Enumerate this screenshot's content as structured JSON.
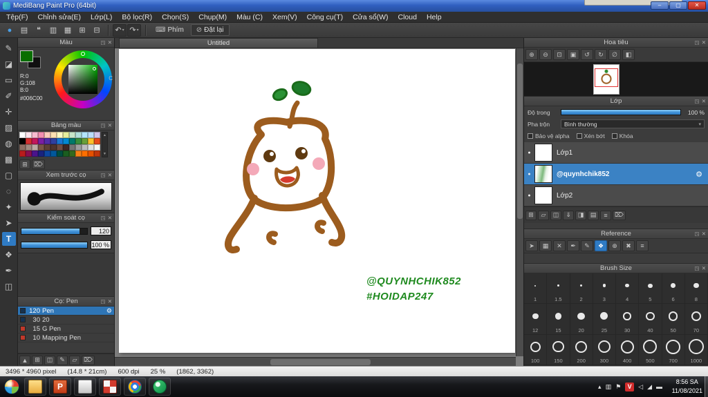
{
  "window": {
    "title": "MediBang Paint Pro (64bit)",
    "controls": [
      {
        "name": "minimize-button",
        "glyph": "–"
      },
      {
        "name": "maximize-button",
        "glyph": "▢"
      },
      {
        "name": "close-button",
        "glyph": "✕"
      }
    ]
  },
  "menu": {
    "items": [
      "Tệp(F)",
      "Chỉnh sửa(E)",
      "Lớp(L)",
      "Bộ lọc(R)",
      "Chọn(S)",
      "Chụp(M)",
      "Màu (C)",
      "Xem(V)",
      "Công cụ(T)",
      "Cửa sổ(W)",
      "Cloud",
      "Help"
    ]
  },
  "main_toolbar": {
    "icons": [
      {
        "name": "cloud-sync-icon",
        "glyph": "●",
        "color": "#4aa0e8"
      },
      {
        "name": "save-icon",
        "glyph": "▤"
      },
      {
        "name": "comment-icon",
        "glyph": "❝"
      },
      {
        "name": "panels-icon",
        "glyph": "▥"
      },
      {
        "name": "image-icon",
        "glyph": "▦"
      },
      {
        "name": "grid-icon",
        "glyph": "⊞"
      },
      {
        "name": "snap-icon",
        "glyph": "⊟"
      }
    ],
    "undo_glyph": "↶",
    "redo_glyph": "↷",
    "phim_icon": "⌨",
    "phim_label": "Phím",
    "reset_icon": "⊘",
    "reset_label": "Đặt lại"
  },
  "tools": [
    {
      "name": "pen-tool",
      "glyph": "✎"
    },
    {
      "name": "eraser-tool",
      "glyph": "◪"
    },
    {
      "name": "shape-brush-tool",
      "glyph": "▭"
    },
    {
      "name": "marker-tool",
      "glyph": "✐"
    },
    {
      "name": "move-tool",
      "glyph": "✛"
    },
    {
      "name": "fill-tool",
      "glyph": "▨"
    },
    {
      "name": "bucket-tool",
      "glyph": "◍"
    },
    {
      "name": "gradient-tool",
      "glyph": "▩"
    },
    {
      "name": "select-tool",
      "glyph": "▢"
    },
    {
      "name": "lasso-tool",
      "glyph": "◌"
    },
    {
      "name": "magic-wand-tool",
      "glyph": "✦"
    },
    {
      "name": "select-pen-tool",
      "glyph": "➤"
    },
    {
      "name": "text-tool",
      "glyph": "T",
      "active": true
    },
    {
      "name": "hand-tool",
      "glyph": "❖"
    },
    {
      "name": "eyedropper-tool",
      "glyph": "✒"
    },
    {
      "name": "divide-tool",
      "glyph": "◫"
    }
  ],
  "color_panel": {
    "title": "Màu",
    "r": "R:0",
    "g": "G:108",
    "b": "B:0",
    "hex": "#006C00",
    "c_label": "C",
    "foreground": "#0a6e00",
    "background": "#101010"
  },
  "palette": {
    "title": "Bảng màu",
    "colors": [
      "#ffffff",
      "#fce4ec",
      "#f8bbd0",
      "#f48fb1",
      "#ffccbc",
      "#ffe0b2",
      "#fff9c4",
      "#e6ee9c",
      "#c8e6c9",
      "#b2dfdb",
      "#b3e5fc",
      "#bbdefb",
      "#d1c4e9",
      "#000000",
      "#d32f2f",
      "#c2185b",
      "#7b1fa2",
      "#512da8",
      "#303f9f",
      "#1976d2",
      "#0288d1",
      "#00796b",
      "#388e3c",
      "#689f38",
      "#fbc02d",
      "#e64a19",
      "#8d6e63",
      "#a1887f",
      "#bcaaa4",
      "#795548",
      "#5d4037",
      "#4e342e",
      "#6d4c41",
      "#3e2723",
      "#757575",
      "#9e9e9e",
      "#bdbdbd",
      "#e0e0e0",
      "#f5f5f5",
      "#b71c1c",
      "#880e4f",
      "#4a148c",
      "#1a237e",
      "#0d47a1",
      "#01579b",
      "#004d40",
      "#1b5e20",
      "#33691e",
      "#f57f17",
      "#ff6f00",
      "#e65100",
      "#bf360c"
    ],
    "footer_icons": [
      {
        "name": "add-color-icon",
        "glyph": "⊞"
      },
      {
        "name": "delete-color-icon",
        "glyph": "⌦"
      }
    ]
  },
  "preview": {
    "title": "Xem trước cọ"
  },
  "control": {
    "title": "Kiểm soát cọ",
    "size": "120",
    "opacity": "100 %"
  },
  "brushes": {
    "title": "Cọ: Pen",
    "items": [
      {
        "size": "120",
        "name": "Pen",
        "chip": "#16324f",
        "selected": true
      },
      {
        "size": "30",
        "name": "20",
        "chip": "#16324f"
      },
      {
        "size": "15",
        "name": "G Pen",
        "chip": "#c0392b"
      },
      {
        "size": "10",
        "name": "Mapping Pen",
        "chip": "#c0392b"
      }
    ],
    "footer_icons": [
      {
        "name": "brush-up-icon",
        "glyph": "▲"
      },
      {
        "name": "add-brush-icon",
        "glyph": "⊞"
      },
      {
        "name": "duplicate-brush-icon",
        "glyph": "◫"
      },
      {
        "name": "edit-brush-icon",
        "glyph": "✎"
      },
      {
        "name": "brush-folder-icon",
        "glyph": "▱"
      },
      {
        "name": "delete-brush-icon",
        "glyph": "⌦"
      }
    ]
  },
  "canvas": {
    "tab": "Untitled",
    "handle1": "@QUYNHCHIK852",
    "handle2": "#HOIDAP247"
  },
  "navigator": {
    "title": "Hoa tiêu",
    "icons": [
      {
        "name": "zoom-in-icon",
        "glyph": "⊕"
      },
      {
        "name": "zoom-out-icon",
        "glyph": "⊖"
      },
      {
        "name": "fit-window-icon",
        "glyph": "⊡"
      },
      {
        "name": "actual-size-icon",
        "glyph": "▣"
      },
      {
        "name": "rotate-left-icon",
        "glyph": "↺"
      },
      {
        "name": "rotate-right-icon",
        "glyph": "↻"
      },
      {
        "name": "reset-view-icon",
        "glyph": "∅"
      },
      {
        "name": "flip-view-icon",
        "glyph": "◧"
      }
    ]
  },
  "layer_panel": {
    "title": "Lớp",
    "opacity_label": "Độ trong",
    "opacity_value": "100 %",
    "blend_label": "Pha trộn",
    "blend_value": "Bình thường",
    "checks": [
      "Bảo vệ alpha",
      "Xén bớt",
      "Khóa"
    ],
    "layers": [
      {
        "name": "Lớp1"
      },
      {
        "name": "@quynhchik852",
        "selected": true,
        "art": true
      },
      {
        "name": "Lớp2"
      }
    ],
    "footer_icons": [
      {
        "name": "add-layer-icon",
        "glyph": "⊞"
      },
      {
        "name": "add-folder-icon",
        "glyph": "▱"
      },
      {
        "name": "duplicate-layer-icon",
        "glyph": "◫"
      },
      {
        "name": "merge-down-icon",
        "glyph": "⇓"
      },
      {
        "name": "layer-mask-icon",
        "glyph": "◨"
      },
      {
        "name": "layer-settings-icon",
        "glyph": "▤"
      },
      {
        "name": "layer-menu-icon",
        "glyph": "≡"
      },
      {
        "name": "delete-layer-icon",
        "glyph": "⌦"
      }
    ]
  },
  "reference": {
    "title": "Reference",
    "icons": [
      {
        "name": "cursor-icon",
        "glyph": "➤"
      },
      {
        "name": "image-ref-icon",
        "glyph": "▦"
      },
      {
        "name": "close-ref-icon",
        "glyph": "✕"
      },
      {
        "name": "eyedropper-ref-icon",
        "glyph": "✒"
      },
      {
        "name": "pencil-ref-icon",
        "glyph": "✎"
      },
      {
        "name": "hand-ref-icon",
        "glyph": "❖",
        "active": true
      },
      {
        "name": "zoom-ref-icon",
        "glyph": "⊕"
      },
      {
        "name": "clear-ref-icon",
        "glyph": "✖"
      },
      {
        "name": "menu-ref-icon",
        "glyph": "≡"
      }
    ]
  },
  "brush_size": {
    "title": "Brush Size",
    "sizes": [
      1,
      1.5,
      2,
      3,
      4,
      5,
      6,
      8,
      12,
      15,
      20,
      25,
      30,
      40,
      50,
      70,
      100,
      150,
      200,
      300,
      400,
      500,
      700,
      1000
    ]
  },
  "status": {
    "dimensions": "3496 * 4960 pixel",
    "print_size": "(14.8 * 21cm)",
    "dpi": "600 dpi",
    "zoom": "25 %",
    "coords": "(1862, 3362)"
  },
  "taskbar": {
    "apps": [
      {
        "name": "start-button",
        "type": "orb"
      },
      {
        "name": "explorer-icon",
        "type": "folder"
      },
      {
        "name": "powerpoint-icon",
        "type": "ppt",
        "glyph": "P"
      },
      {
        "name": "app-icon",
        "type": "gray"
      },
      {
        "name": "tiles-app-icon",
        "type": "tiles"
      },
      {
        "name": "chrome-icon",
        "type": "chrome"
      },
      {
        "name": "medibang-icon",
        "type": "medibang"
      }
    ],
    "tray": [
      {
        "name": "tray-expand-icon",
        "glyph": "▴"
      },
      {
        "name": "display-icon",
        "glyph": "▥"
      },
      {
        "name": "flag-icon",
        "glyph": "⚑"
      },
      {
        "name": "unikey-icon",
        "glyph": "V",
        "red": true
      },
      {
        "name": "speaker-icon",
        "glyph": "◁"
      },
      {
        "name": "network-icon",
        "glyph": "◢"
      },
      {
        "name": "battery-icon",
        "glyph": "▬"
      }
    ],
    "time": "8:56 SA",
    "date": "11/08/2021"
  },
  "ui": {
    "popout_glyph": "◳",
    "close_glyph": "✕",
    "gear_glyph": "⚙",
    "dropdown_glyph": "▾",
    "eye_glyph": "●",
    "scroll_up_glyph": "▲",
    "scroll_down_glyph": "▼"
  }
}
